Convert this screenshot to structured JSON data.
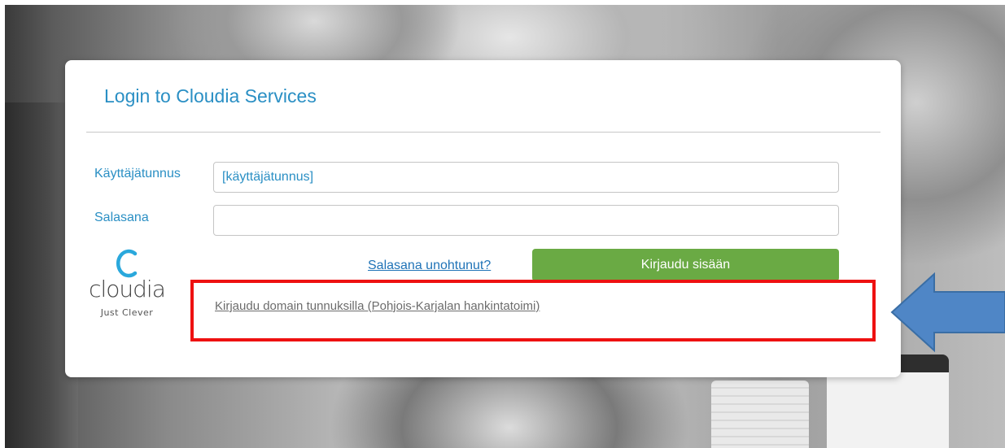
{
  "card": {
    "title": "Login to Cloudia Services"
  },
  "form": {
    "username_label": "Käyttäjätunnus",
    "username_value": "[käyttäjätunnus]",
    "password_label": "Salasana",
    "password_value": "",
    "forgot_link": "Salasana unohtunut?",
    "login_button": "Kirjaudu sisään",
    "domain_login_link": "Kirjaudu domain tunnuksilla (Pohjois-Karjalan hankintatoimi)"
  },
  "brand": {
    "wordmark": "cloudia",
    "tagline": "Just Clever",
    "icon": "cloudia-c-logo-icon"
  },
  "annotation": {
    "highlight_color": "#ee1111",
    "arrow_color": "#4f86c6",
    "arrow_icon": "arrow-left-icon"
  },
  "colors": {
    "accent": "#2a8fc4",
    "button": "#6aaa44",
    "link": "#1f73b7"
  }
}
